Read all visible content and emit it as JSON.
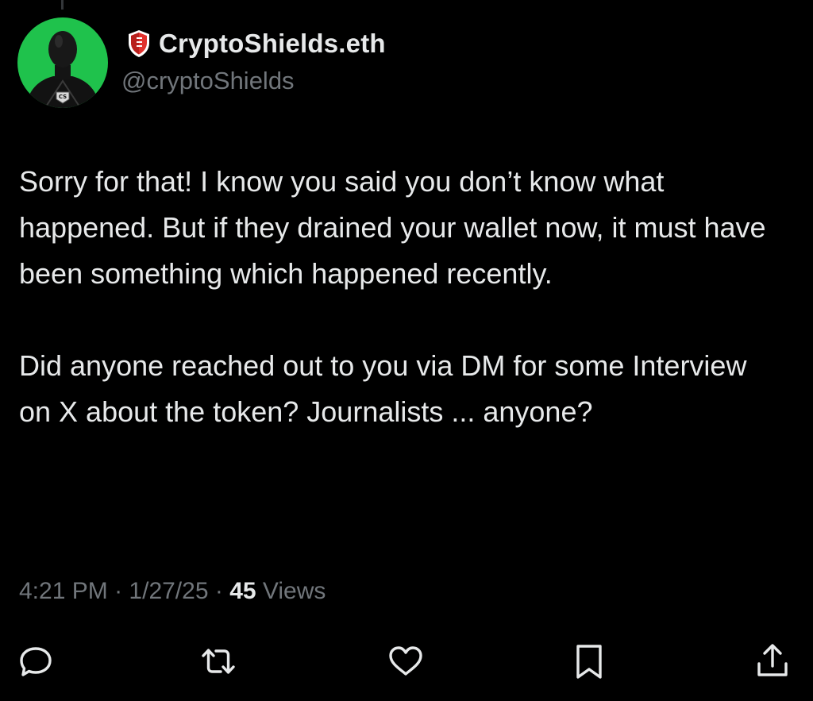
{
  "author": {
    "display_name": "CryptoShields.eth",
    "handle": "@cryptoShields",
    "avatar_badge": "CS",
    "avatar_bg": "#1fc24c",
    "badge_icon": "shield-icon"
  },
  "tweet": {
    "paragraphs": [
      "Sorry for that! I know you said you don’t know what happened. But if they drained your wallet now, it must have been something which happened recently.",
      "Did anyone reached out to you via DM for some Interview on X about the token? Journalists ... anyone?"
    ]
  },
  "meta": {
    "time": "4:21 PM",
    "separator": "·",
    "date": "1/27/25",
    "views_count": "45",
    "views_label": "Views"
  },
  "actions": [
    {
      "name": "reply",
      "icon": "reply-icon"
    },
    {
      "name": "retweet",
      "icon": "retweet-icon"
    },
    {
      "name": "like",
      "icon": "heart-icon"
    },
    {
      "name": "bookmark",
      "icon": "bookmark-icon"
    },
    {
      "name": "share",
      "icon": "share-icon"
    }
  ],
  "colors": {
    "background": "#000000",
    "primary_text": "#e7e9ea",
    "secondary_text": "#71767b",
    "badge_red": "#e0312d"
  }
}
